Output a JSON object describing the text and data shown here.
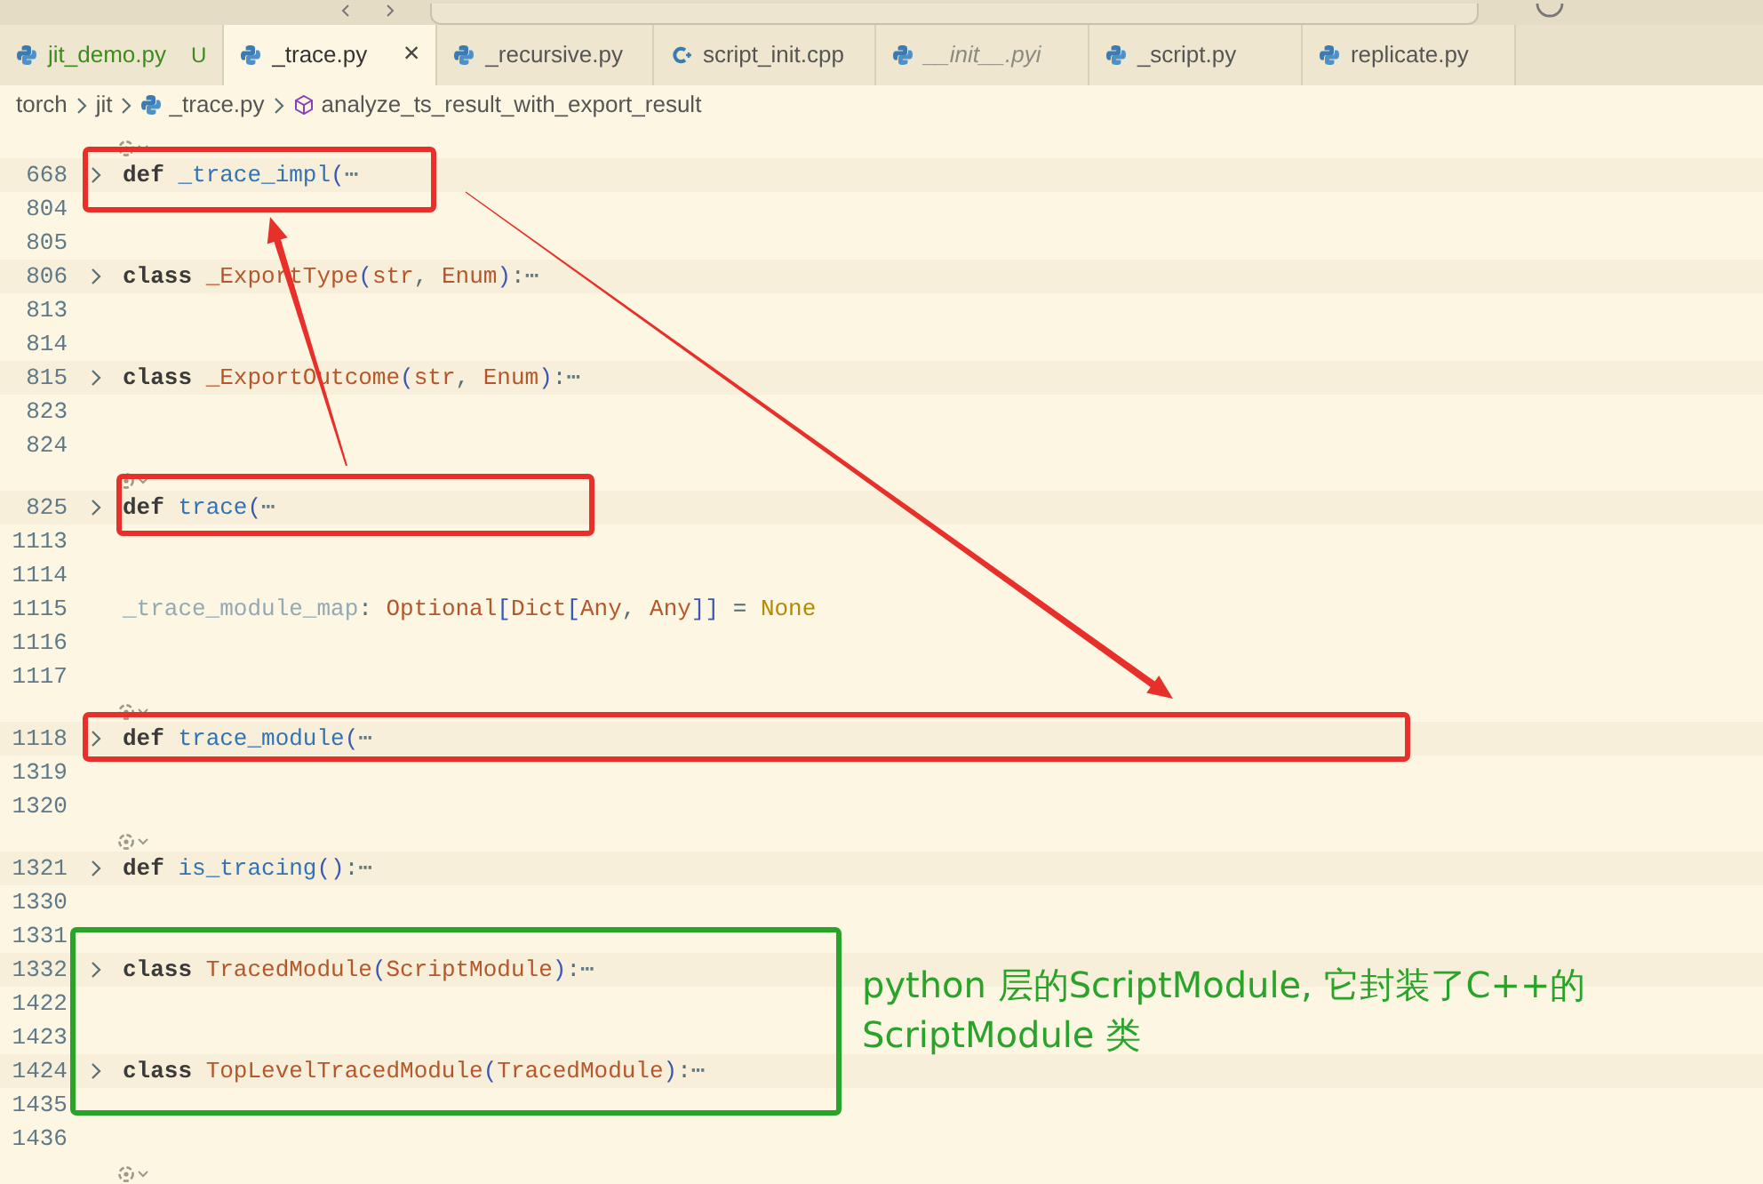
{
  "tabs": [
    {
      "label": "jit_demo.py",
      "kind": "python",
      "selected": false,
      "italic": false,
      "color": "#3c8c1e",
      "badge": "U"
    },
    {
      "label": "_trace.py",
      "kind": "python",
      "selected": true,
      "italic": false,
      "close": "×"
    },
    {
      "label": "_recursive.py",
      "kind": "python",
      "selected": false,
      "italic": false
    },
    {
      "label": "script_init.cpp",
      "kind": "cpp",
      "selected": false,
      "italic": false
    },
    {
      "label": "__init__.pyi",
      "kind": "python",
      "selected": false,
      "italic": true
    },
    {
      "label": "_script.py",
      "kind": "python",
      "selected": false,
      "italic": false
    },
    {
      "label": "replicate.py",
      "kind": "python",
      "selected": false,
      "italic": false
    }
  ],
  "breadcrumb": [
    {
      "label": "torch",
      "kind": "folder"
    },
    {
      "label": "jit",
      "kind": "folder"
    },
    {
      "label": "_trace.py",
      "kind": "python"
    },
    {
      "label": "analyze_ts_result_with_export_result",
      "kind": "symbol"
    }
  ],
  "code_lines": [
    {
      "number": "668",
      "folded": true,
      "lens": true,
      "tokens": [
        {
          "kind": "keyword",
          "text": "def "
        },
        {
          "kind": "function",
          "text": "_trace_impl"
        },
        {
          "kind": "paren",
          "text": "("
        },
        {
          "kind": "ellipsis",
          "text": "⋯"
        }
      ]
    },
    {
      "number": "804",
      "folded": false,
      "lens": false
    },
    {
      "number": "805",
      "folded": false,
      "lens": false
    },
    {
      "number": "806",
      "folded": true,
      "lens": false,
      "tokens": [
        {
          "kind": "keyword",
          "text": "class "
        },
        {
          "kind": "class",
          "text": "_ExportType"
        },
        {
          "kind": "paren",
          "text": "("
        },
        {
          "kind": "type",
          "text": "str"
        },
        {
          "kind": "punct",
          "text": ", "
        },
        {
          "kind": "type",
          "text": "Enum"
        },
        {
          "kind": "paren",
          "text": ")"
        },
        {
          "kind": "punct",
          "text": ":"
        },
        {
          "kind": "ellipsis",
          "text": "⋯"
        }
      ]
    },
    {
      "number": "813",
      "folded": false,
      "lens": false
    },
    {
      "number": "814",
      "folded": false,
      "lens": false
    },
    {
      "number": "815",
      "folded": true,
      "lens": false,
      "tokens": [
        {
          "kind": "keyword",
          "text": "class "
        },
        {
          "kind": "class",
          "text": "_ExportOutcome"
        },
        {
          "kind": "paren",
          "text": "("
        },
        {
          "kind": "type",
          "text": "str"
        },
        {
          "kind": "punct",
          "text": ", "
        },
        {
          "kind": "type",
          "text": "Enum"
        },
        {
          "kind": "paren",
          "text": ")"
        },
        {
          "kind": "punct",
          "text": ":"
        },
        {
          "kind": "ellipsis",
          "text": "⋯"
        }
      ]
    },
    {
      "number": "823",
      "folded": false,
      "lens": false
    },
    {
      "number": "824",
      "folded": false,
      "lens": false
    },
    {
      "number": "825",
      "folded": true,
      "lens": true,
      "tokens": [
        {
          "kind": "keyword",
          "text": "def "
        },
        {
          "kind": "function",
          "text": "trace"
        },
        {
          "kind": "paren",
          "text": "("
        },
        {
          "kind": "ellipsis",
          "text": "⋯"
        }
      ]
    },
    {
      "number": "1113",
      "folded": false,
      "lens": false
    },
    {
      "number": "1114",
      "folded": false,
      "lens": false
    },
    {
      "number": "1115",
      "folded": false,
      "lens": false,
      "tokens": [
        {
          "kind": "variable",
          "text": "_trace_module_map"
        },
        {
          "kind": "punct",
          "text": ": "
        },
        {
          "kind": "type",
          "text": "Optional"
        },
        {
          "kind": "paren",
          "text": "["
        },
        {
          "kind": "type",
          "text": "Dict"
        },
        {
          "kind": "paren",
          "text": "["
        },
        {
          "kind": "type",
          "text": "Any"
        },
        {
          "kind": "punct",
          "text": ", "
        },
        {
          "kind": "type",
          "text": "Any"
        },
        {
          "kind": "paren",
          "text": "]]"
        },
        {
          "kind": "punct",
          "text": " = "
        },
        {
          "kind": "constant",
          "text": "None"
        }
      ]
    },
    {
      "number": "1116",
      "folded": false,
      "lens": false
    },
    {
      "number": "1117",
      "folded": false,
      "lens": false
    },
    {
      "number": "1118",
      "folded": true,
      "lens": true,
      "tokens": [
        {
          "kind": "keyword",
          "text": "def "
        },
        {
          "kind": "function",
          "text": "trace_module"
        },
        {
          "kind": "paren",
          "text": "("
        },
        {
          "kind": "ellipsis",
          "text": "⋯"
        }
      ]
    },
    {
      "number": "1319",
      "folded": false,
      "lens": false
    },
    {
      "number": "1320",
      "folded": false,
      "lens": false
    },
    {
      "number": "1321",
      "folded": true,
      "lens": true,
      "tokens": [
        {
          "kind": "keyword",
          "text": "def "
        },
        {
          "kind": "function",
          "text": "is_tracing"
        },
        {
          "kind": "paren",
          "text": "()"
        },
        {
          "kind": "punct",
          "text": ":"
        },
        {
          "kind": "ellipsis",
          "text": "⋯"
        }
      ]
    },
    {
      "number": "1330",
      "folded": false,
      "lens": false
    },
    {
      "number": "1331",
      "folded": false,
      "lens": false
    },
    {
      "number": "1332",
      "folded": true,
      "lens": false,
      "tokens": [
        {
          "kind": "keyword",
          "text": "class "
        },
        {
          "kind": "class",
          "text": "TracedModule"
        },
        {
          "kind": "paren",
          "text": "("
        },
        {
          "kind": "class",
          "text": "ScriptModule"
        },
        {
          "kind": "paren",
          "text": ")"
        },
        {
          "kind": "punct",
          "text": ":"
        },
        {
          "kind": "ellipsis",
          "text": "⋯"
        }
      ]
    },
    {
      "number": "1422",
      "folded": false,
      "lens": false
    },
    {
      "number": "1423",
      "folded": false,
      "lens": false
    },
    {
      "number": "1424",
      "folded": true,
      "lens": false,
      "tokens": [
        {
          "kind": "keyword",
          "text": "class "
        },
        {
          "kind": "class",
          "text": "TopLevelTracedModule"
        },
        {
          "kind": "paren",
          "text": "("
        },
        {
          "kind": "class",
          "text": "TracedModule"
        },
        {
          "kind": "paren",
          "text": ")"
        },
        {
          "kind": "punct",
          "text": ":"
        },
        {
          "kind": "ellipsis",
          "text": "⋯"
        }
      ]
    },
    {
      "number": "1435",
      "folded": false,
      "lens": false
    },
    {
      "number": "1436",
      "folded": false,
      "lens": false
    }
  ],
  "trailing_lens": true,
  "annotation": {
    "text": "python 层的ScriptModule, 它封装了C++的ScriptModule 类"
  }
}
